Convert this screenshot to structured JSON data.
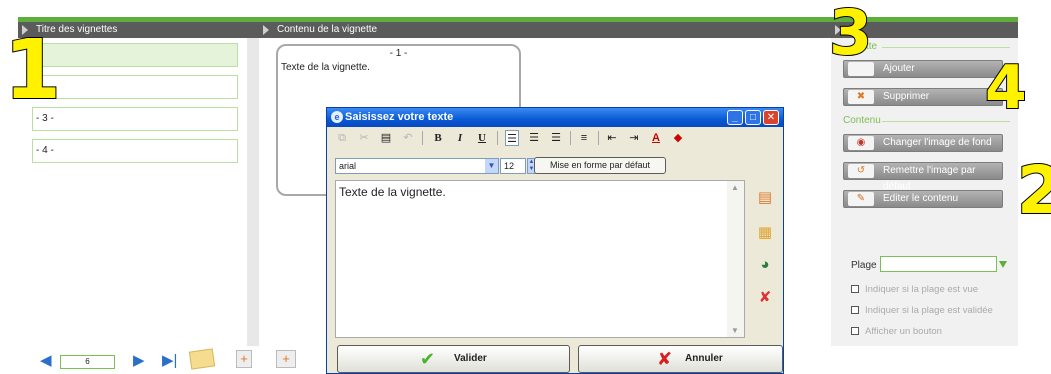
{
  "headers": {
    "left": "Titre des vignettes",
    "center": "Contenu de la vignette"
  },
  "vignette_list": [
    "-",
    "-",
    "- 3 -",
    "- 4 -"
  ],
  "preview": {
    "number": "- 1 -",
    "text": "Texte de la vignette."
  },
  "right": {
    "section1": "tte",
    "ajouter": "Ajouter",
    "supprimer": "Supprimer",
    "section2": "Contenu",
    "changer": "Changer l'image de fond",
    "remettre": "Remettre l'image par défaut",
    "editer": "Editer le contenu",
    "plage_label": "Plage",
    "options": [
      "Indiquer si la plage est vue",
      "Indiquer si la plage est validée",
      "Afficher un bouton"
    ]
  },
  "bottom": {
    "page": "6"
  },
  "overlay_numbers": {
    "n1": "1",
    "n2": "2",
    "n3": "3",
    "n4": "4"
  },
  "dialog": {
    "title": "Saisissez votre texte",
    "font": "arial",
    "size": "12",
    "reset_format": "Mise en forme par défaut",
    "content": "Texte de la vignette.",
    "ok": "Valider",
    "cancel": "Annuler"
  },
  "colors": {
    "accent_green": "#5fae3c",
    "header_gray": "#5b5b5b",
    "xp_blue": "#0a59d4"
  }
}
